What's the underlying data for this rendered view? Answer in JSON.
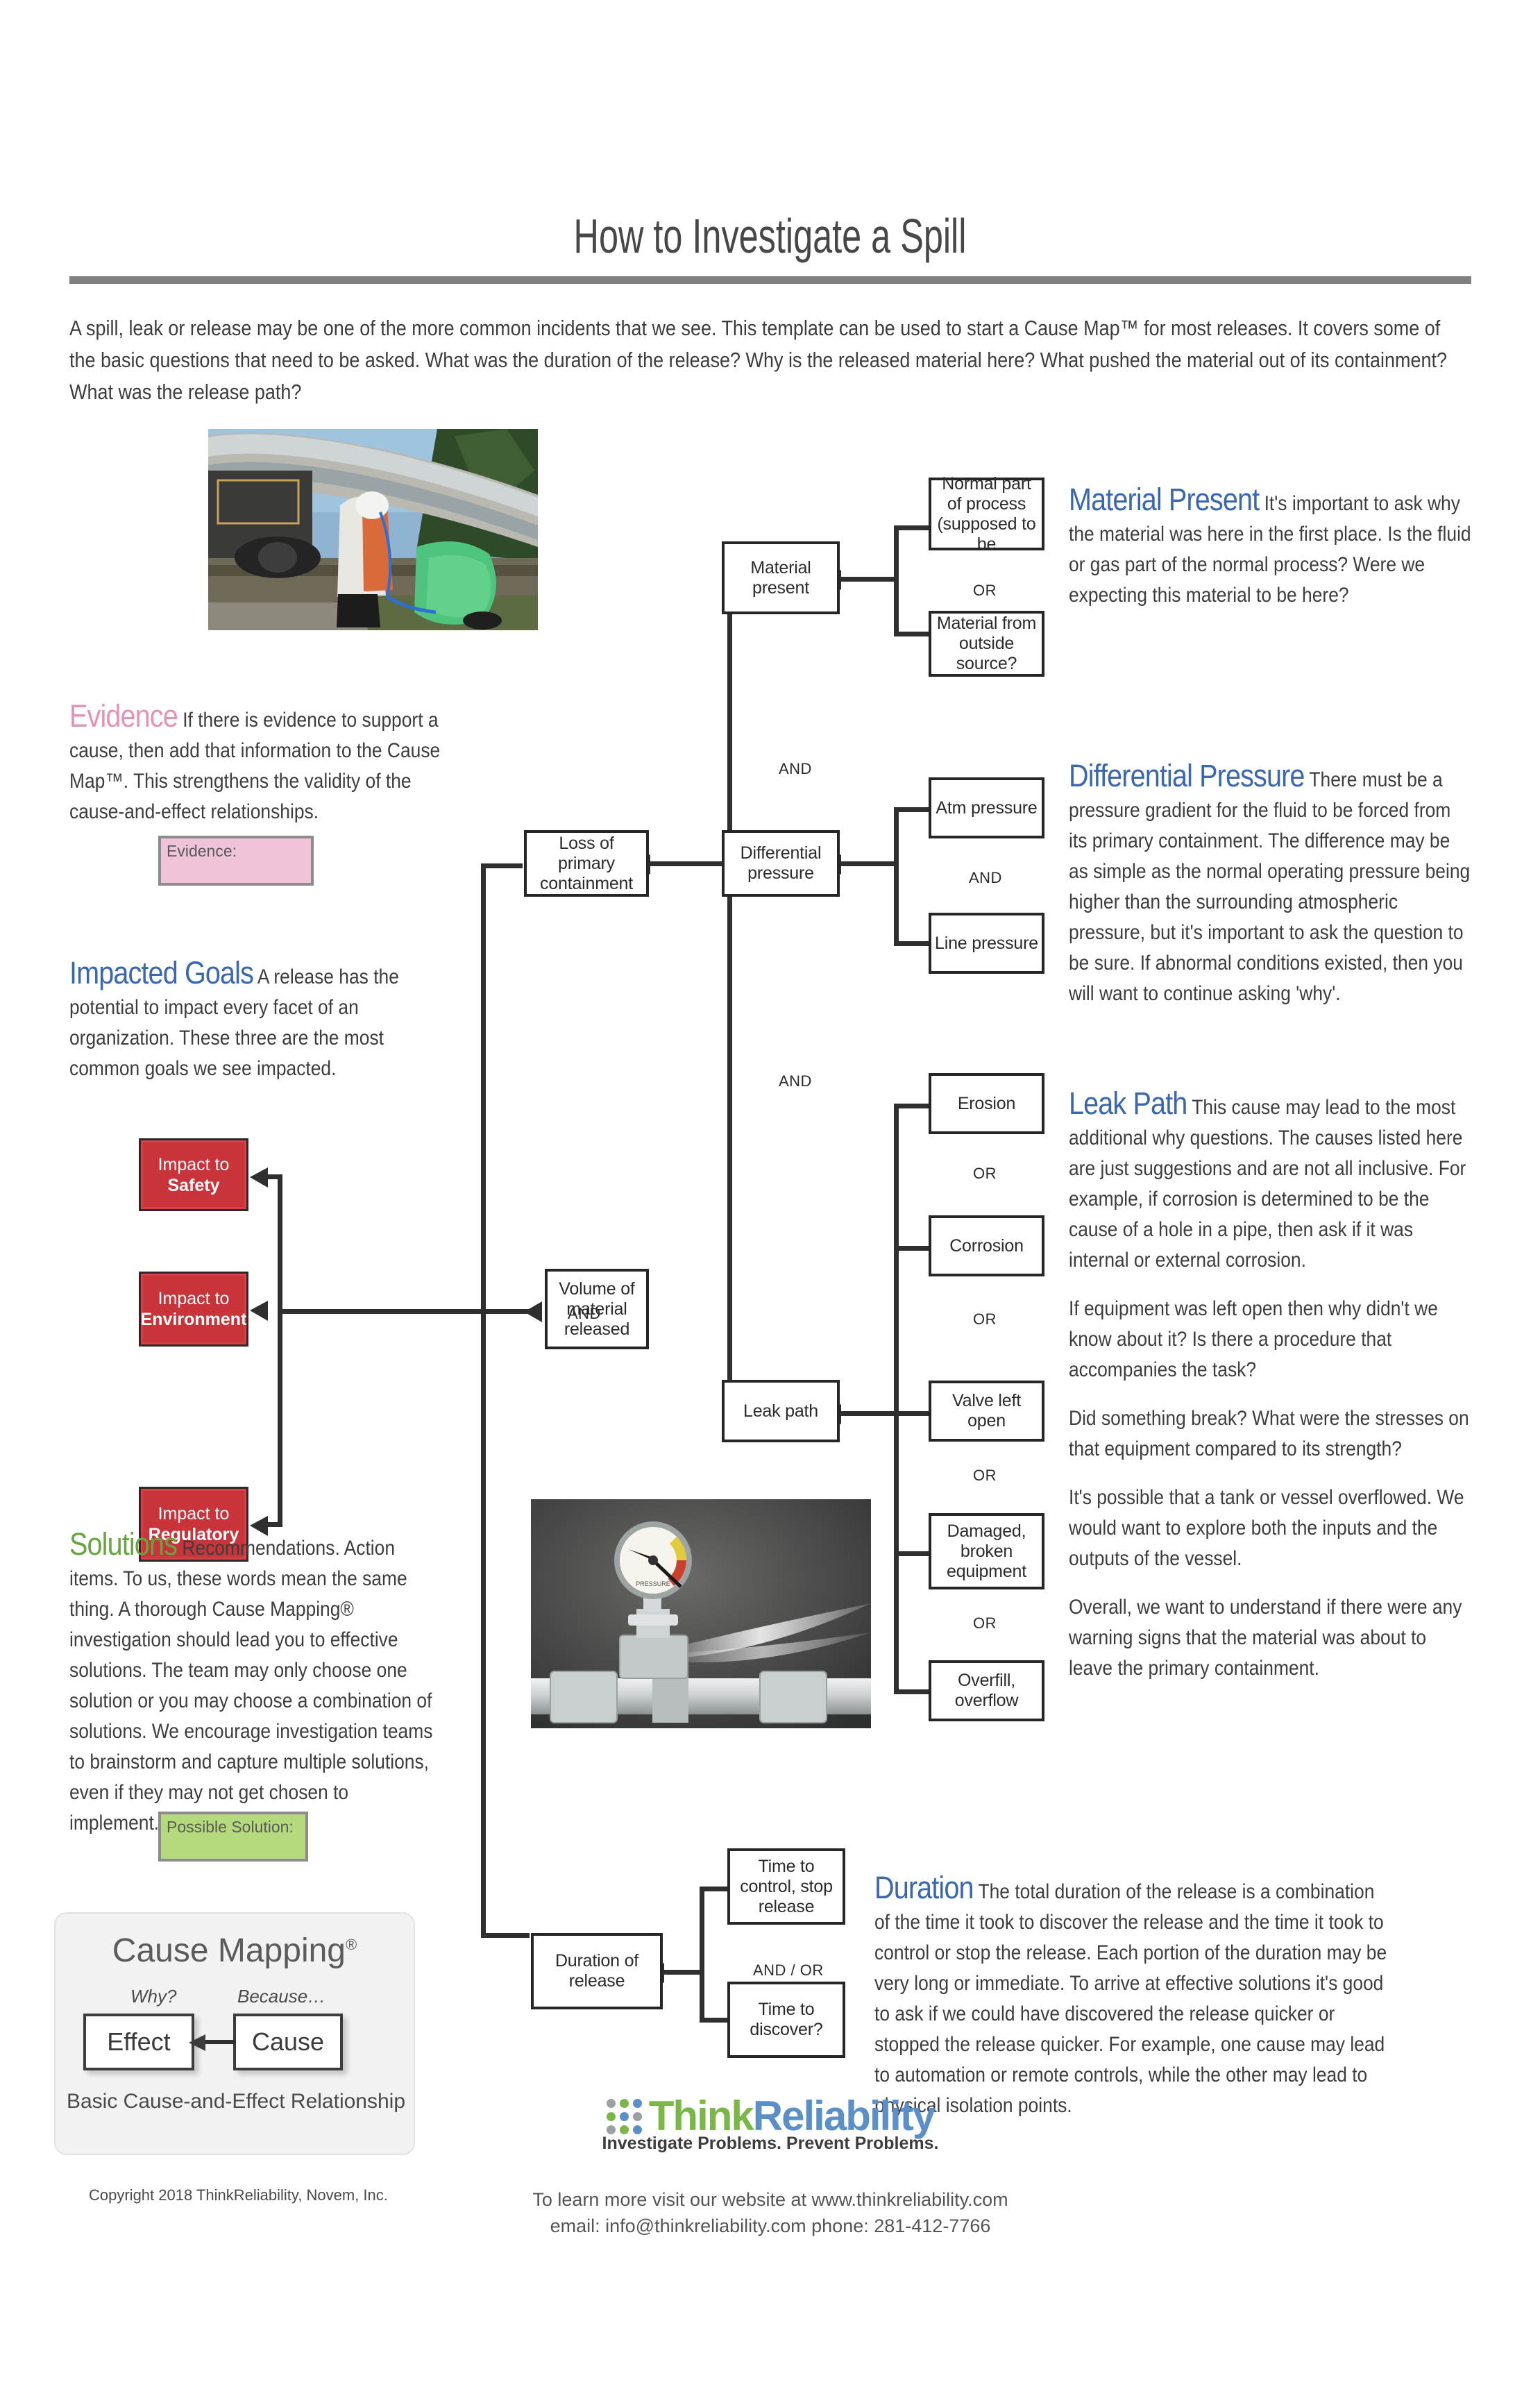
{
  "title": "How to Investigate a Spill",
  "intro": "A spill, leak or release may be one of the more common incidents that we see. This template can be used to start a Cause Map™ for most releases. It covers some of the basic questions that need to be asked. What was the duration of the release? Why is the released material here? What pushed the material out of its containment? What was the release path?",
  "colors": {
    "accent_blue": "#3b67b0",
    "accent_pink": "#e592b8",
    "accent_green": "#6aa442",
    "goal_red": "#c9343b",
    "rule_gray": "#808080"
  },
  "sections": {
    "material_present": {
      "heading": "Material Present",
      "body": "It's important to ask why the material was here in the first place. Is the fluid or gas part of the normal process? Were we expecting this material to be here?"
    },
    "differential_pressure": {
      "heading": "Differential Pressure",
      "body": "There must be a pressure gradient for the fluid to be forced from its primary containment. The difference may be as simple as the normal operating pressure being higher than the surrounding atmospheric pressure, but it's important to ask the question to be sure. If abnormal conditions existed, then you will want to continue asking 'why'."
    },
    "leak_path": {
      "heading": "Leak Path",
      "body1": "This cause may lead to the most additional why questions. The causes listed here are just suggestions and are not all inclusive. For example, if corrosion is determined to be the cause of a hole in a pipe, then ask if it was internal or external corrosion.",
      "body2": "If equipment was left open then why didn't we know about it?  Is there a procedure that accompanies the task?",
      "body3": "Did something break? What were the stresses on that equipment compared to its strength?",
      "body4": "It's possible that a tank or vessel overflowed. We would want to explore both the inputs and the outputs of the vessel.",
      "body5": "Overall, we want to understand if there were any warning signs that the material was about to leave the primary containment."
    },
    "duration": {
      "heading": "Duration",
      "body": "The total duration of the release is a combination of the time it took to discover the release and the time it took to control or stop the release. Each portion of the duration may be very long or immediate. To arrive at effective solutions it's good to ask if we could have discovered the release quicker or stopped the release quicker. For example, one cause may lead to automation or remote controls, while the other may lead to physical isolation points."
    },
    "evidence": {
      "heading": "Evidence",
      "body": "If there is evidence to support a cause, then add that information to the Cause Map™. This strengthens the validity of the cause-and-effect relationships.",
      "box_label": "Evidence:"
    },
    "impacted_goals": {
      "heading": "Impacted Goals",
      "body": "A release has the potential to impact every facet of an organization. These three are the most common goals we see impacted."
    },
    "solutions": {
      "heading": "Solutions",
      "body": "Recommendations. Action items. To us, these words mean the same thing. A thorough Cause Mapping® investigation should lead you to effective solutions. The team may only choose one solution or you may choose a combination of solutions. We encourage investigation teams to brainstorm and capture multiple solutions, even if they may not get chosen to implement.",
      "box_label": "Possible Solution:"
    }
  },
  "cause_map": {
    "boxes": {
      "loss_primary_containment": "Loss of primary containment",
      "material_present": "Material present",
      "normal_part_of_process": "Normal part of process (supposed to be",
      "material_outside_source": "Material from outside source?",
      "differential_pressure": "Differential pressure",
      "atm_pressure": "Atm pressure",
      "line_pressure": "Line pressure",
      "leak_path": "Leak path",
      "erosion": "Erosion",
      "corrosion": "Corrosion",
      "valve_left_open": "Valve left open",
      "damaged_broken_equipment": "Damaged, broken equipment",
      "overfill_overflow": "Overfill, overflow",
      "volume_of_material_released": "Volume of material released",
      "duration_of_release": "Duration of release",
      "time_to_control": "Time to control, stop release",
      "time_to_discover": "Time to discover?"
    },
    "goals": [
      {
        "prefix": "Impact to",
        "name": "Safety"
      },
      {
        "prefix": "Impact to",
        "name": "Environment"
      },
      {
        "prefix": "Impact to",
        "name": "Regulatory"
      }
    ],
    "connector_labels": {
      "and_material": "AND",
      "or_material": "OR",
      "and_pressure": "AND",
      "and_leak": "AND",
      "and_volume": "AND",
      "or_erosion": "OR",
      "or_corrosion": "OR",
      "or_valve": "OR",
      "or_damaged": "OR",
      "and_or_duration": "AND / OR"
    }
  },
  "cause_mapping_panel": {
    "title": "Cause Mapping",
    "registered_mark": "®",
    "why_label": "Why?",
    "because_label": "Because…",
    "effect_label": "Effect",
    "cause_label": "Cause",
    "caption": "Basic Cause-and-Effect  Relationship"
  },
  "copyright": "Copyright 2018 ThinkReliability,  Novem, Inc.",
  "footer": {
    "logo_think": "Think",
    "logo_reliability": "Reliability",
    "logo_tagline": "Investigate Problems. Prevent Problems.",
    "line1": "To learn more visit our website at www.thinkreliability.com",
    "line2": "email:  info@thinkreliability.com  phone: 281-412-7766"
  }
}
